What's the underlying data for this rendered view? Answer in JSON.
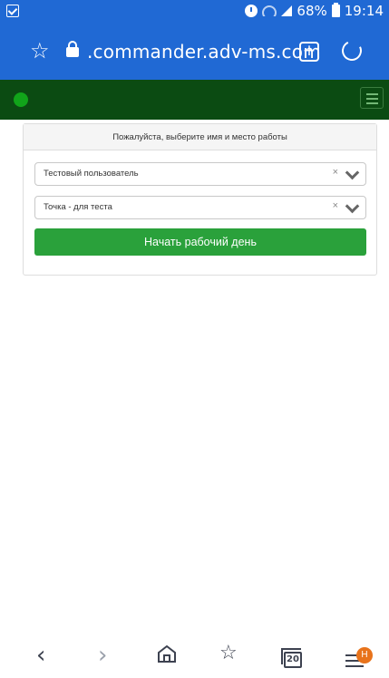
{
  "status_bar": {
    "battery": "68%",
    "time": "19:14"
  },
  "browser": {
    "url": ".commander.adv-ms.com"
  },
  "card": {
    "header": "Пожалуйста, выберите имя и место работы",
    "user_select": {
      "value": "Тестовый пользователь"
    },
    "location_select": {
      "value": "Точка - для теста"
    },
    "clear_symbol": "×",
    "start_button_label": "Начать рабочий день"
  },
  "bottom_nav": {
    "tabs_count": "20",
    "menu_badge": "H"
  },
  "colors": {
    "browser_bar": "#2069d4",
    "app_header": "#0b4b12",
    "online_dot": "#11a41a",
    "primary_button": "#2aa13b",
    "badge": "#e8731b"
  }
}
